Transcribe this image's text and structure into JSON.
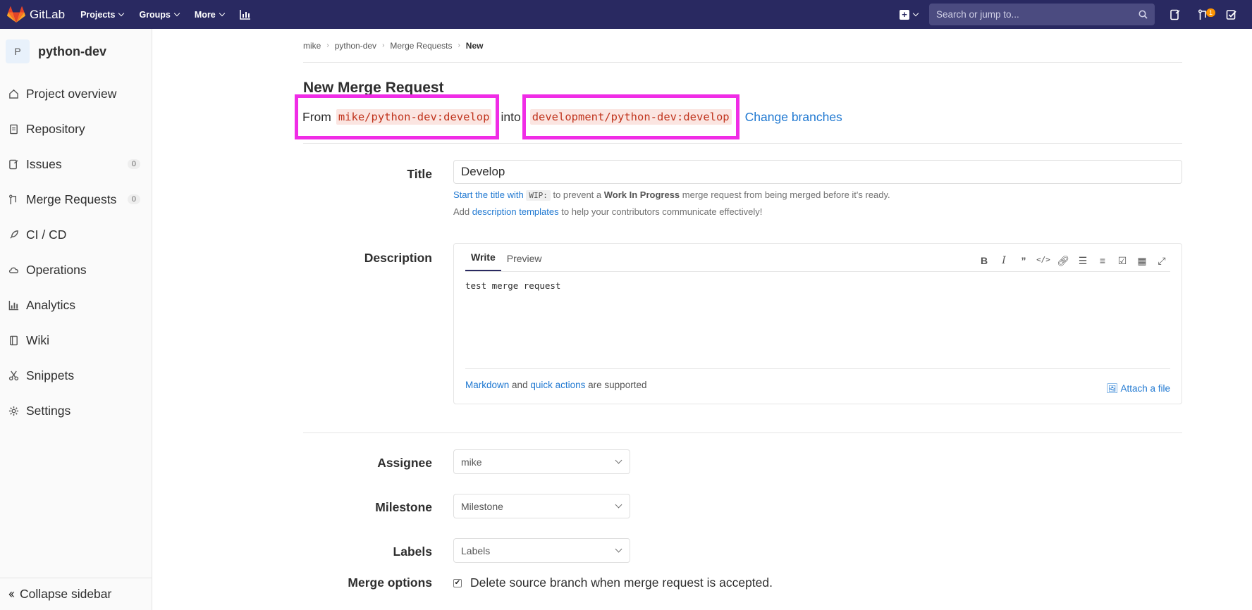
{
  "navbar": {
    "brand": "GitLab",
    "menu": [
      "Projects",
      "Groups",
      "More"
    ],
    "search_placeholder": "Search or jump to...",
    "mr_count": "1"
  },
  "sidebar": {
    "avatar_letter": "P",
    "project_name": "python-dev",
    "items": [
      {
        "label": "Project overview",
        "icon": "home-icon"
      },
      {
        "label": "Repository",
        "icon": "doc-icon"
      },
      {
        "label": "Issues",
        "icon": "issues-icon",
        "count": "0"
      },
      {
        "label": "Merge Requests",
        "icon": "merge-icon",
        "count": "0"
      },
      {
        "label": "CI / CD",
        "icon": "rocket-icon"
      },
      {
        "label": "Operations",
        "icon": "cloud-icon"
      },
      {
        "label": "Analytics",
        "icon": "chart-icon"
      },
      {
        "label": "Wiki",
        "icon": "book-icon"
      },
      {
        "label": "Snippets",
        "icon": "scissors-icon"
      },
      {
        "label": "Settings",
        "icon": "gear-icon"
      }
    ],
    "collapse_label": "Collapse sidebar"
  },
  "breadcrumb": [
    "mike",
    "python-dev",
    "Merge Requests",
    "New"
  ],
  "page_title": "New Merge Request",
  "branches": {
    "from_label": "From",
    "source": "mike/python-dev:develop",
    "into_label": "into",
    "target": "development/python-dev:develop",
    "change_label": "Change branches"
  },
  "form": {
    "title_label": "Title",
    "title_value": "Develop",
    "wip_help_link": "Start the title with",
    "wip_code": "WIP:",
    "wip_help_mid": "to prevent a",
    "wip_help_bold": "Work In Progress",
    "wip_help_end": "merge request from being merged before it's ready.",
    "tmpl_help_start": "Add",
    "tmpl_help_link": "description templates",
    "tmpl_help_end": "to help your contributors communicate effectively!",
    "description_label": "Description",
    "tab_write": "Write",
    "tab_preview": "Preview",
    "description_value": "test merge request",
    "md_link": "Markdown",
    "md_and": "and",
    "qa_link": "quick actions",
    "md_supported": "are supported",
    "attach_label": "Attach a file",
    "assignee_label": "Assignee",
    "assignee_value": "mike",
    "milestone_label": "Milestone",
    "milestone_value": "Milestone",
    "labels_label": "Labels",
    "labels_value": "Labels",
    "merge_options_label": "Merge options",
    "delete_branch_label": "Delete source branch when merge request is accepted."
  },
  "colors": {
    "navbar": "#292961",
    "link": "#1f78d1",
    "highlight": "#f02ce6",
    "code_text": "#c0341d"
  }
}
